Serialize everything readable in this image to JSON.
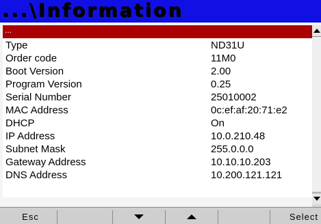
{
  "header": {
    "title": "...\\Information",
    "background_color": "#1010e4"
  },
  "selected_row": {
    "label": "...",
    "highlight_color": "#aa0000"
  },
  "rows": [
    {
      "label": "Type",
      "value": "ND31U"
    },
    {
      "label": "Order code",
      "value": "11M0"
    },
    {
      "label": "Boot Version",
      "value": "2.00"
    },
    {
      "label": "Program Version",
      "value": "0.25"
    },
    {
      "label": "Serial Number",
      "value": "25010002"
    },
    {
      "label": "MAC Address",
      "value": "0c:ef:af:20:71:e2"
    },
    {
      "label": "DHCP",
      "value": "On"
    },
    {
      "label": "IP Address",
      "value": "10.0.210.48"
    },
    {
      "label": "Subnet Mask",
      "value": "255.0.0.0"
    },
    {
      "label": "Gateway Address",
      "value": "10.10.10.203"
    },
    {
      "label": "DNS Address",
      "value": "10.200.121.121"
    }
  ],
  "softkeys": {
    "esc_label": "Esc",
    "down_icon": "triangle-down-icon",
    "up_icon": "triangle-up-icon",
    "select_label": "Select"
  },
  "scrollbar": {
    "up_icon": "scroll-up-icon",
    "down_icon": "scroll-down-icon"
  }
}
